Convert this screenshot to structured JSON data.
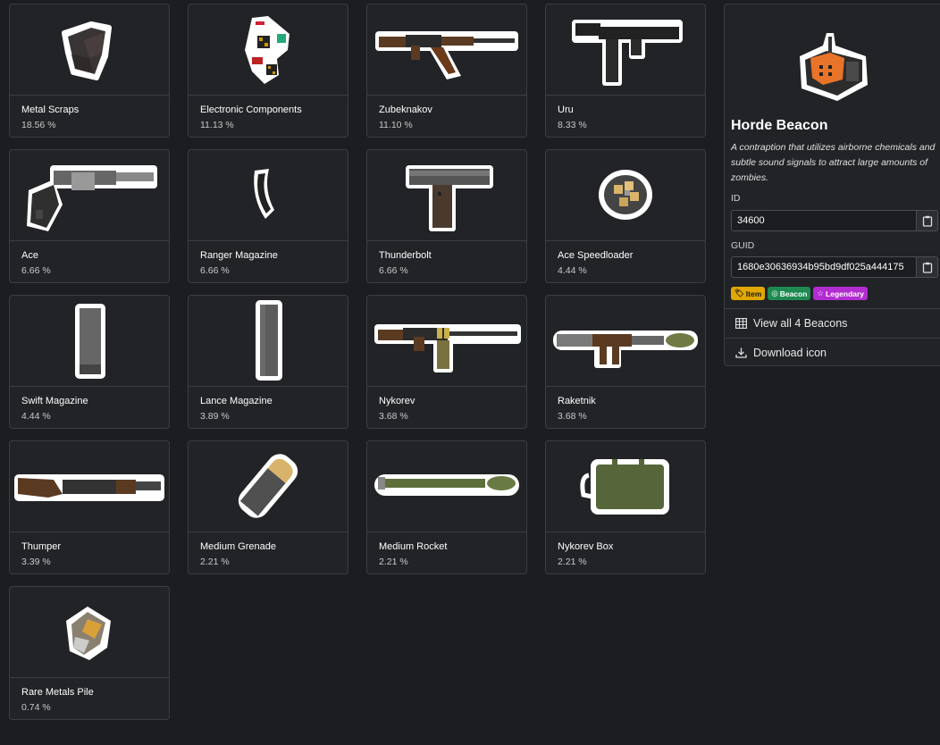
{
  "items": [
    {
      "name": "Metal Scraps",
      "pct": "18.56 %",
      "icon": "metal-scraps-icon"
    },
    {
      "name": "Electronic Components",
      "pct": "11.13 %",
      "icon": "electronic-components-icon"
    },
    {
      "name": "Zubeknakov",
      "pct": "11.10 %",
      "icon": "rifle-icon"
    },
    {
      "name": "Uru",
      "pct": "8.33 %",
      "icon": "smg-icon"
    },
    {
      "name": "Ace",
      "pct": "6.66 %",
      "icon": "revolver-icon"
    },
    {
      "name": "Ranger Magazine",
      "pct": "6.66 %",
      "icon": "magazine-icon"
    },
    {
      "name": "Thunderbolt",
      "pct": "6.66 %",
      "icon": "pistol-icon"
    },
    {
      "name": "Ace Speedloader",
      "pct": "4.44 %",
      "icon": "speedloader-icon"
    },
    {
      "name": "Swift Magazine",
      "pct": "4.44 %",
      "icon": "magazine-icon"
    },
    {
      "name": "Lance Magazine",
      "pct": "3.89 %",
      "icon": "magazine-icon"
    },
    {
      "name": "Nykorev",
      "pct": "3.68 %",
      "icon": "machine-gun-icon"
    },
    {
      "name": "Raketnik",
      "pct": "3.68 %",
      "icon": "rocket-launcher-icon"
    },
    {
      "name": "Thumper",
      "pct": "3.39 %",
      "icon": "grenade-launcher-icon"
    },
    {
      "name": "Medium Grenade",
      "pct": "2.21 %",
      "icon": "grenade-icon"
    },
    {
      "name": "Medium Rocket",
      "pct": "2.21 %",
      "icon": "rocket-icon"
    },
    {
      "name": "Nykorev Box",
      "pct": "2.21 %",
      "icon": "ammo-box-icon"
    },
    {
      "name": "Rare Metals Pile",
      "pct": "0.74 %",
      "icon": "rare-metals-icon"
    }
  ],
  "detail": {
    "title": "Horde Beacon",
    "description": "A contraption that utilizes airborne chemicals and subtle sound signals to attract large amounts of zombies.",
    "id_label": "ID",
    "id_value": "34600",
    "guid_label": "GUID",
    "guid_value": "1680e30636934b95bd9df025a444175",
    "tags": [
      "Item",
      "Beacon",
      "Legendary"
    ],
    "view_all": "View all 4 Beacons",
    "download": "Download icon"
  },
  "colors": {
    "tag_item": "#e0a800",
    "tag_beacon": "#1e8a52",
    "tag_legendary": "#b22cd0",
    "background": "#1b1d21",
    "card": "#212327"
  }
}
